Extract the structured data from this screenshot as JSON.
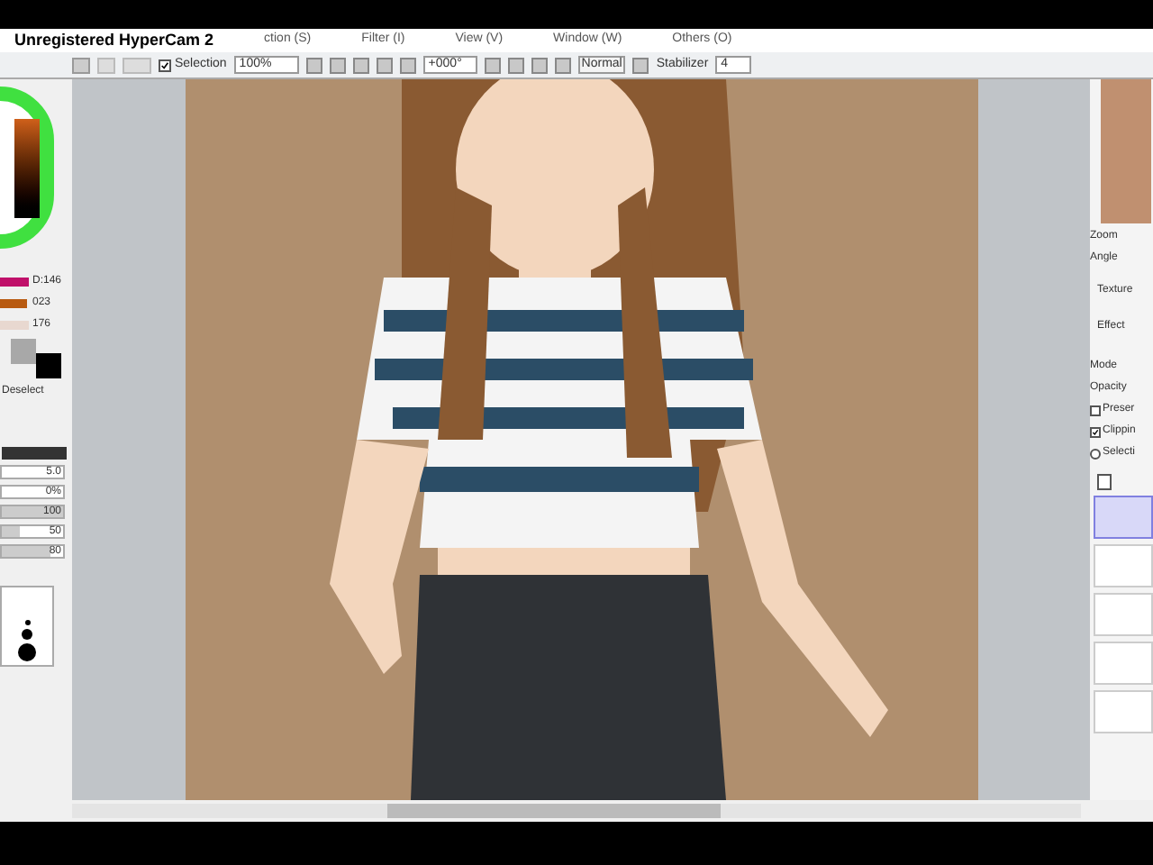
{
  "recorder_banner": "Unregistered HyperCam 2",
  "menu": [
    "ction (S)",
    "Filter (I)",
    "View (V)",
    "Window (W)",
    "Others (O)"
  ],
  "toolbar": {
    "selection": {
      "label": "Selection",
      "checked": true
    },
    "zoom": "100%",
    "angle": "+000°",
    "mode": "Normal",
    "stabilizer_label": "Stabilizer",
    "stabilizer": "4"
  },
  "color_sliders": [
    {
      "reading": "D:146",
      "level": 0.95,
      "color": "#c0106a"
    },
    {
      "reading": "023",
      "level": 0.9,
      "color": "#b85a10"
    },
    {
      "reading": "176",
      "level": 0.95,
      "color": "#e8d8d0"
    }
  ],
  "deselect": "Deselect",
  "brush_fields": [
    {
      "value": "5.0"
    },
    {
      "value": "0%"
    },
    {
      "value": "100",
      "level": 1
    },
    {
      "value": "50",
      "level": 0.3
    },
    {
      "value": "80",
      "level": 0.8
    }
  ],
  "navigator": {
    "zoom_label": "Zoom",
    "angle_label": "Angle"
  },
  "layer_props": {
    "texture": "Texture",
    "effect": "Effect",
    "mode": "Mode",
    "opacity": "Opacity"
  },
  "layer_options": [
    {
      "label": "Preser",
      "kind": "checkbox",
      "checked": false
    },
    {
      "label": "Clippin",
      "kind": "checkbox",
      "checked": true
    },
    {
      "label": "Selecti",
      "kind": "radio",
      "checked": false
    }
  ],
  "layers": [
    {
      "selected": true
    },
    {
      "selected": false
    },
    {
      "selected": false
    },
    {
      "selected": false
    },
    {
      "selected": false
    }
  ]
}
